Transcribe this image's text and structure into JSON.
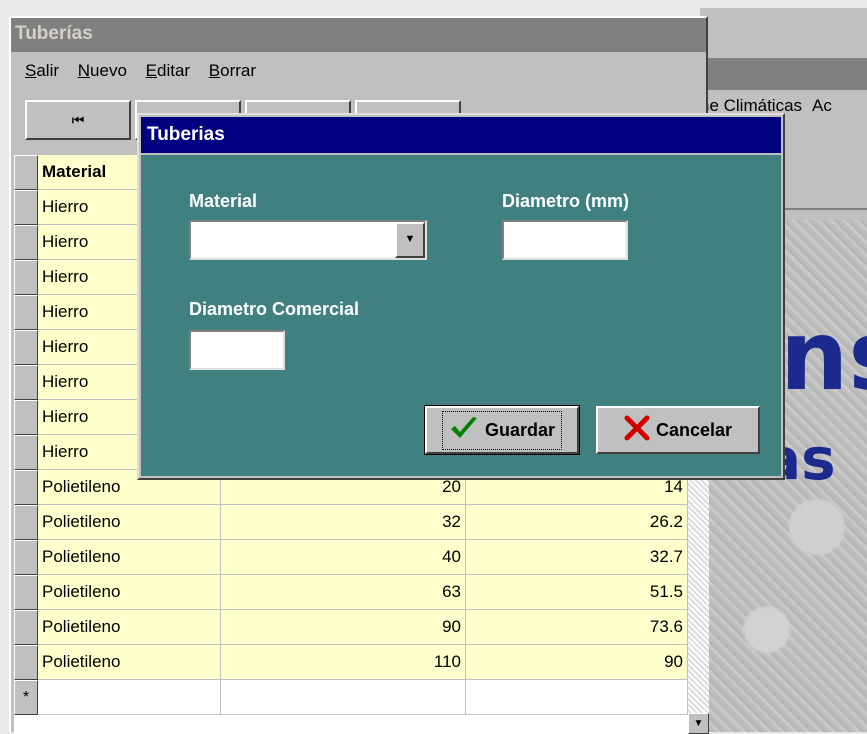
{
  "background_window": {
    "menu": [
      "ne Climáticas",
      "Ac"
    ],
    "big_text_1": "ns",
    "big_text_2": "as"
  },
  "table_window": {
    "title": "Tuberías",
    "menu": [
      {
        "label": "Salir",
        "access_key": "S",
        "rest": "alir"
      },
      {
        "label": "Nuevo",
        "access_key": "N",
        "rest": "uevo"
      },
      {
        "label": "Editar",
        "access_key": "E",
        "rest": "ditar"
      },
      {
        "label": "Borrar",
        "access_key": "B",
        "rest": "orrar"
      }
    ],
    "nav_first_icon": "first-record-icon",
    "nav_first_glyph": "⏮",
    "grid": {
      "column_header": "Material",
      "rows": [
        {
          "material": "Hierro",
          "col2": "",
          "col3": ""
        },
        {
          "material": "Hierro",
          "col2": "",
          "col3": ""
        },
        {
          "material": "Hierro",
          "col2": "",
          "col3": ""
        },
        {
          "material": "Hierro",
          "col2": "",
          "col3": ""
        },
        {
          "material": "Hierro",
          "col2": "",
          "col3": ""
        },
        {
          "material": "Hierro",
          "col2": "",
          "col3": ""
        },
        {
          "material": "Hierro",
          "col2": "",
          "col3": ""
        },
        {
          "material": "Hierro",
          "col2": "",
          "col3": ""
        },
        {
          "material": "Polietileno",
          "col2": "20",
          "col3": "14"
        },
        {
          "material": "Polietileno",
          "col2": "32",
          "col3": "26.2"
        },
        {
          "material": "Polietileno",
          "col2": "40",
          "col3": "32.7"
        },
        {
          "material": "Polietileno",
          "col2": "63",
          "col3": "51.5"
        },
        {
          "material": "Polietileno",
          "col2": "90",
          "col3": "73.6"
        },
        {
          "material": "Polietileno",
          "col2": "110",
          "col3": "90"
        }
      ],
      "new_row_marker": "*",
      "scroll_down_glyph": "▼"
    }
  },
  "dialog": {
    "title": "Tuberias",
    "material_label": "Material",
    "material_value": "",
    "combo_arrow_glyph": "▼",
    "diametro_label": "Diametro (mm)",
    "diametro_value": "",
    "diametro_comercial_label": "Diametro Comercial",
    "diametro_comercial_value": "",
    "save_button": "Guardar",
    "save_icon": "checkmark-icon",
    "save_icon_color": "#008000",
    "cancel_button": "Cancelar",
    "cancel_icon": "x-icon",
    "cancel_icon_color": "#d00000",
    "body_color": "#408080",
    "title_color": "#000080"
  }
}
